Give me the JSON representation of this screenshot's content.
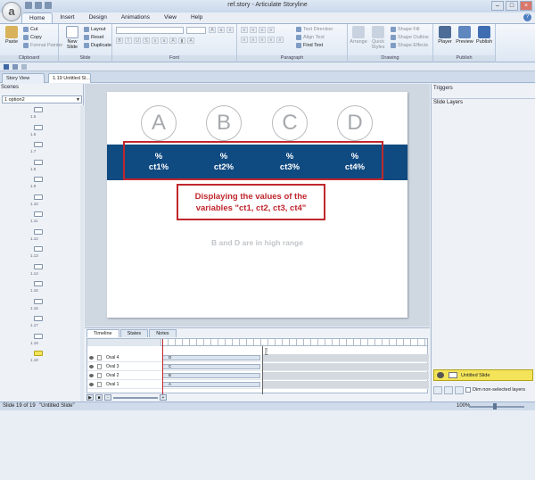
{
  "window": {
    "title": "ref.story - Articulate Storyline",
    "logo_letter": "a"
  },
  "ribbon_tabs": [
    "Home",
    "Insert",
    "Design",
    "Animations",
    "View",
    "Help"
  ],
  "ribbon": {
    "clipboard": {
      "paste": "Paste",
      "cut": "Cut",
      "copy": "Copy",
      "format_painter": "Format Painter",
      "label": "Clipboard"
    },
    "slide": {
      "new_slide": "New Slide",
      "layout": "Layout",
      "reset": "Reset",
      "duplicate": "Duplicate",
      "label": "Slide"
    },
    "font": {
      "label": "Font"
    },
    "paragraph": {
      "text_direction": "Text Direction",
      "align_text": "Align Text",
      "find_text": "Find Text",
      "label": "Paragraph"
    },
    "drawing": {
      "arrange": "Arrange",
      "quick_styles": "Quick Styles",
      "shape_fill": "Shape Fill",
      "shape_outline": "Shape Outline",
      "shape_effects": "Shape Effects",
      "label": "Drawing"
    },
    "publish": {
      "player": "Player",
      "preview": "Preview",
      "publish": "Publish",
      "label": "Publish"
    }
  },
  "doc_tabs": [
    "Story View",
    "1.19 Untitled Sl..."
  ],
  "scenes": {
    "header": "Scenes",
    "selected_scene": "1 option2",
    "thumb_labels": [
      "1.5",
      "1.6",
      "1.7",
      "1.8",
      "1.9",
      "1.10",
      "1.11",
      "1.12",
      "1.13",
      "1.14",
      "1.15",
      "1.16",
      "1.17",
      "1.18",
      "1.19"
    ]
  },
  "slide": {
    "ovals": [
      "A",
      "B",
      "C",
      "D"
    ],
    "percent_symbol": "%",
    "values": [
      "ct1%",
      "ct2%",
      "ct3%",
      "ct4%"
    ],
    "callout": "Displaying the values of the variables \"ct1, ct2, ct3, ct4\"",
    "range_text": "B and D are in high range"
  },
  "panels": {
    "triggers": "Triggers",
    "slide_layers": "Slide Layers",
    "base_layer": "Untitled Slide",
    "dim_label": "Dim non-selected layers"
  },
  "timeline": {
    "tabs": [
      "Timeline",
      "States",
      "Notes"
    ],
    "rows": [
      {
        "name": "Oval 4",
        "bar": "D"
      },
      {
        "name": "Oval 3",
        "bar": "C"
      },
      {
        "name": "Oval 2",
        "bar": "B"
      },
      {
        "name": "Oval 1",
        "bar": "A"
      }
    ],
    "end_label": "End"
  },
  "status": {
    "slide": "Slide 19 of 19",
    "name": "\"Untitled Slide\"",
    "zoom": "100%"
  }
}
